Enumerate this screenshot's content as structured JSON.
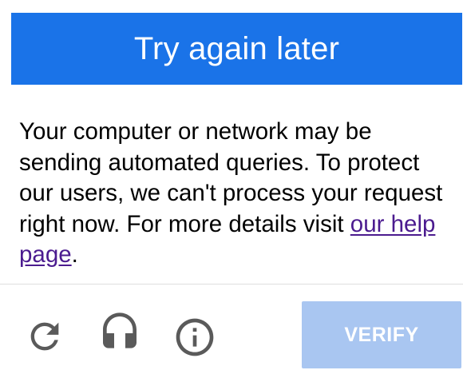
{
  "dialog": {
    "title": "Try again later",
    "message_before_link": "Your computer or network may be sending automated queries. To protect our users, we can't process your request right now. For more details visit ",
    "link_text": "our help page",
    "message_after_link": "."
  },
  "footer": {
    "icons": [
      "reload-icon",
      "headphones-icon",
      "info-icon"
    ],
    "verify_label": "VERIFY"
  },
  "colors": {
    "accent": "#1a73e8",
    "verify_button_bg": "#a9c6f1",
    "icon_gray": "#5a5a5a",
    "link": "#4b1b8f"
  }
}
